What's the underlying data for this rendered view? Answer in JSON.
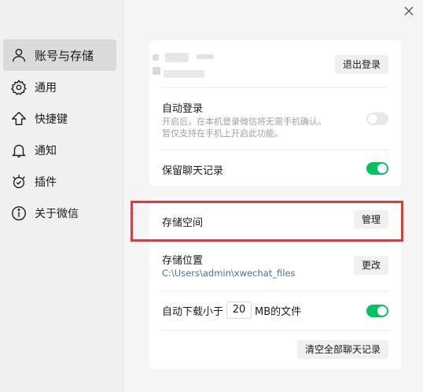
{
  "sidebar": {
    "items": [
      {
        "label": "账号与存储",
        "icon": "user-icon",
        "active": true
      },
      {
        "label": "通用",
        "icon": "gear-icon"
      },
      {
        "label": "快捷键",
        "icon": "shortcut-arrow-icon"
      },
      {
        "label": "通知",
        "icon": "bell-icon"
      },
      {
        "label": "插件",
        "icon": "plugin-icon"
      },
      {
        "label": "关于微信",
        "icon": "info-icon"
      }
    ]
  },
  "account": {
    "logout_label": "退出登录",
    "auto_login_title": "自动登录",
    "auto_login_desc1": "开启后，在本机登录微信将无需手机确认。",
    "auto_login_desc2": "暂仅支持在手机上开启此功能。",
    "auto_login_enabled": false,
    "keep_history_title": "保留聊天记录",
    "keep_history_enabled": true
  },
  "storage": {
    "space_title": "存储空间",
    "manage_label": "管理",
    "location_title": "存储位置",
    "location_path": "C:\\Users\\admin\\xwechat_files",
    "change_label": "更改",
    "auto_download_prefix": "自动下载小于",
    "auto_download_value": "20",
    "auto_download_suffix": "MB的文件",
    "auto_download_enabled": true,
    "clear_all_label": "清空全部聊天记录"
  },
  "colors": {
    "accent_green": "#07c160",
    "highlight_red": "#e0393b"
  }
}
